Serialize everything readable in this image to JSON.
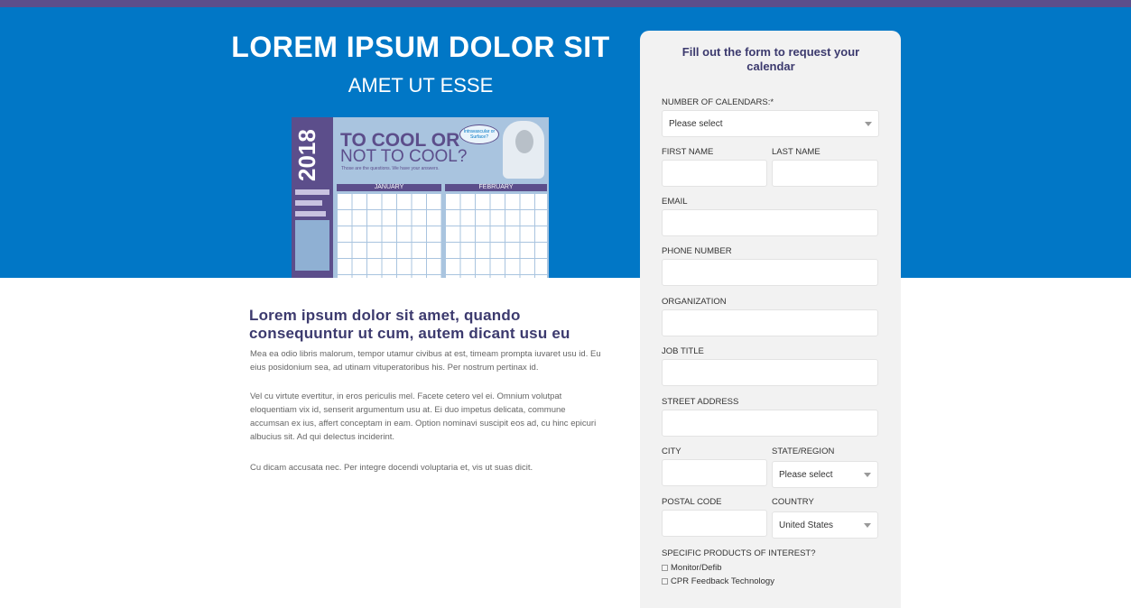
{
  "hero": {
    "title": "LOREM IPSUM DOLOR SIT",
    "subtitle": "AMET UT ESSE"
  },
  "calendar_image": {
    "year": "2018",
    "headline_1": "TO COOL OR",
    "headline_2": "NOT TO COOL?",
    "tagline": "Those are the questions. We have your answers.",
    "bubble": "Intravascular or Surface?",
    "months": [
      "JANUARY",
      "FEBRUARY"
    ]
  },
  "article": {
    "title": "Lorem ipsum dolor sit amet, quando consequuntur ut cum, autem dicant usu eu",
    "paragraphs": [
      "Mea ea odio libris malorum, tempor utamur civibus at est, timeam prompta iuvaret usu id. Eu eius posidonium sea, ad utinam vituperatoribus his. Per nostrum pertinax id.",
      "Vel cu virtute evertitur, in eros periculis mel. Facete cetero vel ei. Omnium volutpat eloquentiam vix id, senserit argumentum usu at. Ei duo impetus delicata, commune accumsan ex ius, affert conceptam in eam. Option nominavi suscipit eos ad, cu hinc epicuri albucius sit. Ad qui delectus inciderint.",
      "Cu dicam accusata nec. Per integre docendi voluptaria et, vis ut suas dicit."
    ]
  },
  "form": {
    "heading": "Fill out the form to request your calendar",
    "num_calendars_label": "NUMBER OF CALENDARS:*",
    "num_calendars_value": "Please select",
    "first_name_label": "FIRST NAME",
    "last_name_label": "LAST NAME",
    "email_label": "EMAIL",
    "phone_label": "PHONE NUMBER",
    "organization_label": "ORGANIZATION",
    "job_title_label": "JOB TITLE",
    "street_label": "STREET ADDRESS",
    "city_label": "CITY",
    "state_label": "STATE/REGION",
    "state_value": "Please select",
    "postal_label": "POSTAL CODE",
    "country_label": "COUNTRY",
    "country_value": "United States",
    "products_label": "SPECIFIC PRODUCTS OF INTEREST?",
    "products": [
      "Monitor/Defib",
      "CPR Feedback Technology"
    ]
  },
  "colors": {
    "hero_blue": "#0177c6",
    "brand_purple": "#5c4e8b",
    "heading_navy": "#3c3a6e",
    "form_bg": "#f2f2f2"
  }
}
